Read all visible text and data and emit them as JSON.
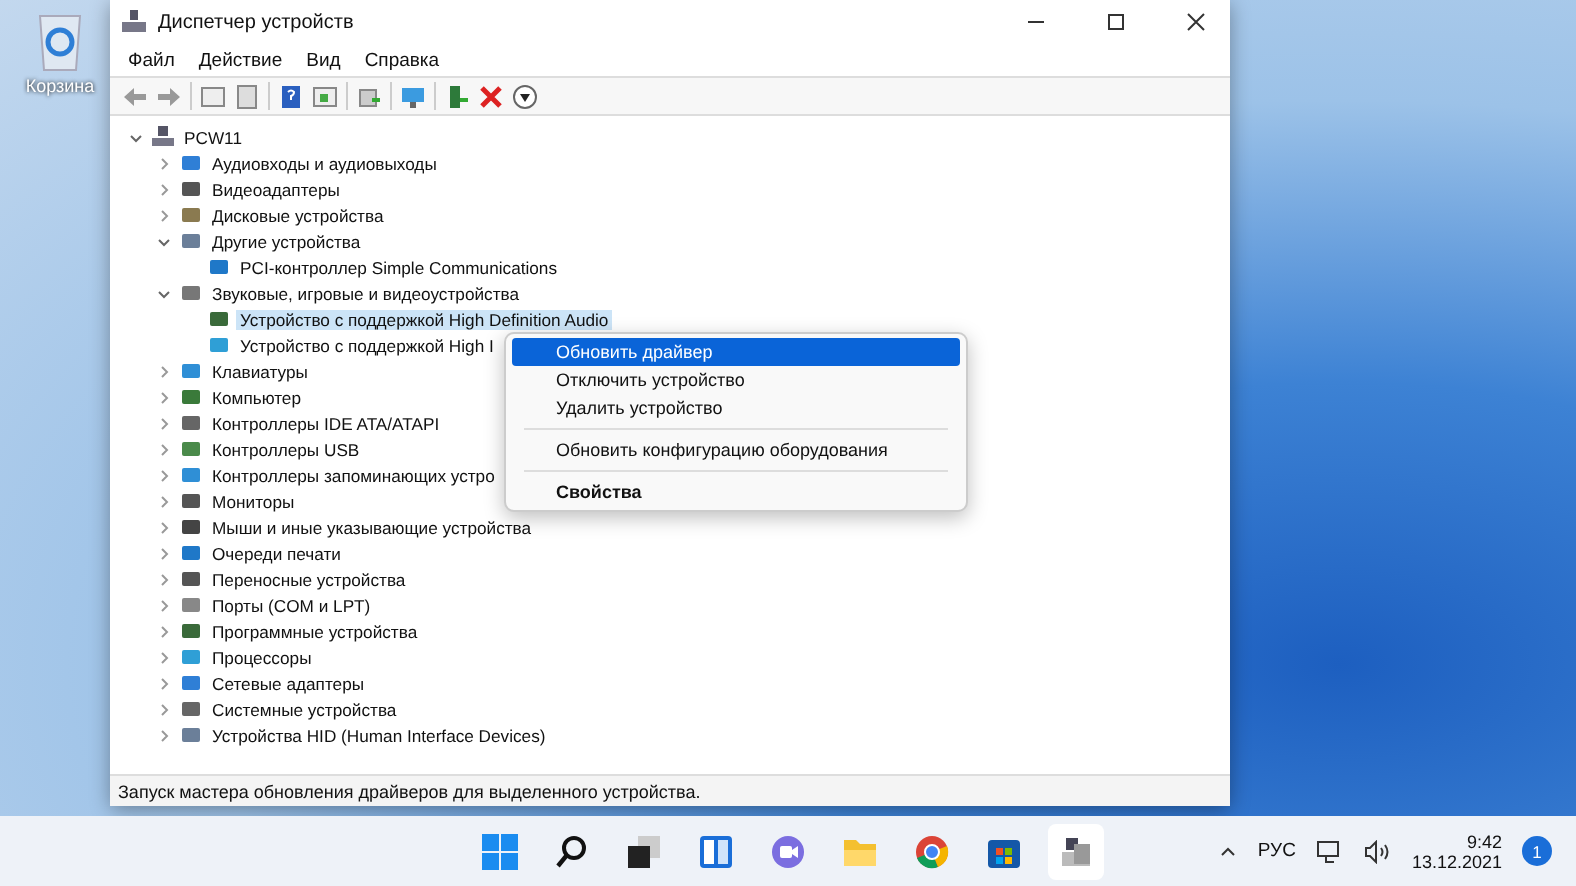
{
  "desktop": {
    "icons": [
      {
        "label": "Корзина"
      }
    ]
  },
  "window": {
    "title": "Диспетчер устройств"
  },
  "menu_bar": [
    "Файл",
    "Действие",
    "Вид",
    "Справка"
  ],
  "tree": {
    "label": "PCW11",
    "expanded": true,
    "selected": false,
    "children": [
      {
        "label": "Аудиовходы и аудиовыходы",
        "expanded": false,
        "selected": false
      },
      {
        "label": "Видеоадаптеры",
        "expanded": false,
        "selected": false
      },
      {
        "label": "Дисковые устройства",
        "expanded": false,
        "selected": false
      },
      {
        "label": "Другие устройства",
        "expanded": true,
        "selected": false,
        "children": [
          {
            "label": "PCI-контроллер Simple Communications",
            "selected": false
          }
        ]
      },
      {
        "label": "Звуковые, игровые и видеоустройства",
        "expanded": true,
        "selected": false,
        "children": [
          {
            "label": "Устройство с поддержкой High Definition Audio",
            "selected": true
          },
          {
            "label": "Устройство с поддержкой High I",
            "selected": false
          }
        ]
      },
      {
        "label": "Клавиатуры",
        "expanded": false,
        "selected": false
      },
      {
        "label": "Компьютер",
        "expanded": false,
        "selected": false
      },
      {
        "label": "Контроллеры IDE ATA/ATAPI",
        "expanded": false,
        "selected": false
      },
      {
        "label": "Контроллеры USB",
        "expanded": false,
        "selected": false
      },
      {
        "label": "Контроллеры запоминающих устро",
        "expanded": false,
        "selected": false
      },
      {
        "label": "Мониторы",
        "expanded": false,
        "selected": false
      },
      {
        "label": "Мыши и иные указывающие устройства",
        "expanded": false,
        "selected": false
      },
      {
        "label": "Очереди печати",
        "expanded": false,
        "selected": false
      },
      {
        "label": "Переносные устройства",
        "expanded": false,
        "selected": false
      },
      {
        "label": "Порты (COM и LPT)",
        "expanded": false,
        "selected": false
      },
      {
        "label": "Программные устройства",
        "expanded": false,
        "selected": false
      },
      {
        "label": "Процессоры",
        "expanded": false,
        "selected": false
      },
      {
        "label": "Сетевые адаптеры",
        "expanded": false,
        "selected": false
      },
      {
        "label": "Системные устройства",
        "expanded": false,
        "selected": false
      },
      {
        "label": "Устройства HID (Human Interface Devices)",
        "expanded": false,
        "selected": false
      }
    ]
  },
  "context_menu": [
    {
      "kind": "item",
      "label": "Обновить драйвер",
      "selected": true
    },
    {
      "kind": "item",
      "label": "Отключить устройство",
      "selected": false
    },
    {
      "kind": "item",
      "label": "Удалить устройство",
      "selected": false
    },
    {
      "kind": "separator"
    },
    {
      "kind": "item",
      "label": "Обновить конфигурацию оборудования",
      "selected": false
    },
    {
      "kind": "separator"
    },
    {
      "kind": "default",
      "label": "Свойства",
      "selected": false
    }
  ],
  "status_bar": "Запуск мастера обновления драйверов для выделенного устройства.",
  "taskbar": {
    "language": "РУС",
    "time": "9:42",
    "date": "13.12.2021",
    "notifications": "1"
  }
}
